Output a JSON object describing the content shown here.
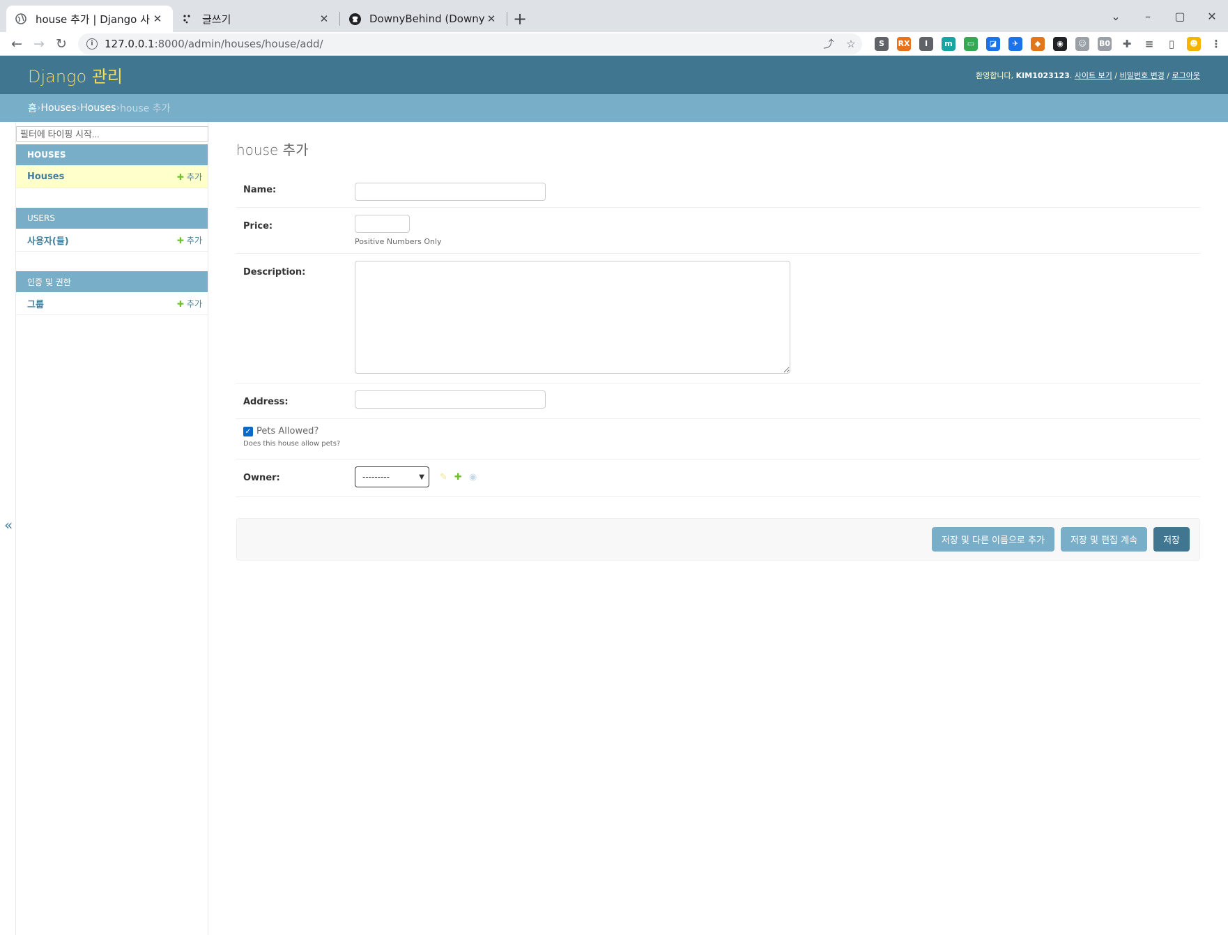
{
  "browser": {
    "tabs": [
      {
        "title": "house 추가 | Django 사이트",
        "active": true
      },
      {
        "title": "글쓰기",
        "active": false
      },
      {
        "title": "DownyBehind (Downyk)",
        "active": false
      }
    ],
    "new_tab": "+",
    "window_controls": [
      "⌄",
      "–",
      "▢",
      "✕"
    ],
    "url_host": "127.0.0.1",
    "url_rest": ":8000/admin/houses/house/add/",
    "extensions": [
      {
        "icon": "s-icon",
        "label": "S",
        "color": "#5f6368"
      },
      {
        "icon": "rss-icon",
        "label": "RX",
        "color": "#e8711a"
      },
      {
        "icon": "i-icon",
        "label": "I",
        "color": "#5f6368"
      },
      {
        "icon": "m-icon",
        "label": "m",
        "color": "#1aa3a3"
      },
      {
        "icon": "screen-icon",
        "label": "▭",
        "color": "#34a853"
      },
      {
        "icon": "translate-icon",
        "label": "◪",
        "color": "#1a73e8"
      },
      {
        "icon": "satellite-icon",
        "label": "✈",
        "color": "#1a73e8"
      },
      {
        "icon": "fox-icon",
        "label": "◆",
        "color": "#e2761b"
      },
      {
        "icon": "target-icon",
        "label": "◉",
        "color": "#202124"
      },
      {
        "icon": "user-icon",
        "label": "☺",
        "color": "#9aa0a6"
      },
      {
        "icon": "text-icon",
        "label": "B0",
        "color": "#9aa0a6"
      },
      {
        "icon": "puzzle-icon",
        "label": "✚",
        "color": "#5f6368"
      },
      {
        "icon": "playlist-icon",
        "label": "≡",
        "color": "#5f6368"
      },
      {
        "icon": "sidepanel-icon",
        "label": "▯",
        "color": "#5f6368"
      },
      {
        "icon": "avatar-icon",
        "label": "☻",
        "color": "#f4b400"
      },
      {
        "icon": "menu-icon",
        "label": "⋮",
        "color": "#5f6368"
      }
    ]
  },
  "header": {
    "brand": "Django 관리",
    "welcome": "환영합니다,",
    "username": "KIM1023123",
    "links": [
      "사이트 보기",
      "비밀번호 변경",
      "로그아웃"
    ],
    "separator": " / "
  },
  "breadcrumbs": {
    "items": [
      "홈",
      "Houses",
      "Houses"
    ],
    "current": "house 추가",
    "separator": " › "
  },
  "sidebar": {
    "filter_placeholder": "필터에 타이핑 시작...",
    "modules": [
      {
        "caption": "HOUSES",
        "rows": [
          {
            "label": "Houses",
            "add": "추가",
            "current": true
          }
        ]
      },
      {
        "caption": "USERS",
        "rows": [
          {
            "label": "사용자(들)",
            "add": "추가",
            "current": false
          }
        ]
      },
      {
        "caption": "인증 및 권한",
        "rows": [
          {
            "label": "그룹",
            "add": "추가",
            "current": false
          }
        ]
      }
    ],
    "collapse": "«"
  },
  "form": {
    "title": "house 추가",
    "name_label": "Name:",
    "name_value": "",
    "price_label": "Price:",
    "price_value": "",
    "price_help": "Positive Numbers Only",
    "description_label": "Description:",
    "description_value": "",
    "address_label": "Address:",
    "address_value": "",
    "pets_label": "Pets Allowed?",
    "pets_checked": true,
    "pets_help": "Does this house allow pets?",
    "owner_label": "Owner:",
    "owner_selected": "---------"
  },
  "buttons": {
    "save_add_another": "저장 및 다른 이름으로 추가",
    "save_continue": "저장 및 편집 계속",
    "save": "저장"
  },
  "colors": {
    "header": "#417690",
    "breadcrumbs": "#79aec8",
    "brand": "#f5dd5d",
    "button": "#79aec8",
    "button_default": "#417690"
  }
}
